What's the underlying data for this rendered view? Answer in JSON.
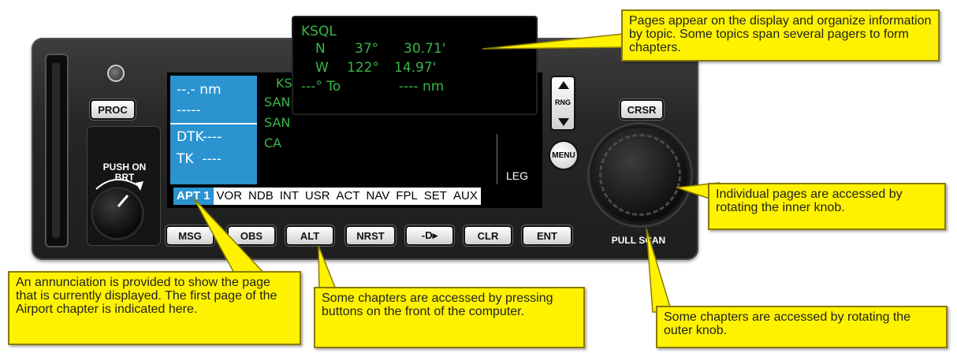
{
  "device": {
    "left_buttons": {
      "proc": "PROC"
    },
    "brightness_knob_label": "PUSH ON\nBRT",
    "right_buttons": {
      "crsr": "CRSR",
      "rng": "RNG",
      "menu": "MENU"
    },
    "outer_knob_label": "PULL SCAN",
    "bottom_buttons": [
      "MSG",
      "OBS",
      "ALT",
      "NRST",
      "-D▸",
      "CLR",
      "ENT"
    ]
  },
  "screen": {
    "nav_box": {
      "distance": "--.- nm",
      "line2": "-----",
      "dtk": "DTK----",
      "tk": "TK  ----"
    },
    "green_partial": [
      "KS",
      "SAN",
      "SAN",
      "CA"
    ],
    "leg_label": "LEG",
    "tabs": [
      "APT 1",
      "VOR",
      "NDB",
      "INT",
      "USR",
      "ACT",
      "NAV",
      "FPL",
      "SET",
      "AUX"
    ],
    "active_tab": "APT 1"
  },
  "popup_screen": {
    "ident": "KSQL",
    "lat_hemi": "N",
    "lat_deg": "37°",
    "lat_min": "30.71'",
    "lon_hemi": "W",
    "lon_deg": "122°",
    "lon_min": "14.97'",
    "to_line": "---° To",
    "dist_line": "---- nm"
  },
  "callouts": {
    "pages": "Pages appear on the display and organize information by topic. Some topics span several pagers to form chapters.",
    "inner_knob": "Individual pages are accessed by rotating the inner knob.",
    "annunciation": "An annunciation is provided to show the page that is currently displayed. The first page of the Airport chapter is indicated here.",
    "buttons": "Some chapters are accessed by pressing buttons on the front of the computer.",
    "outer_knob": "Some chapters are accessed by rotating the outer knob."
  },
  "colors": {
    "callout": "#fff200",
    "screen_green": "#39b54a",
    "screen_blue": "#2a93d0"
  }
}
